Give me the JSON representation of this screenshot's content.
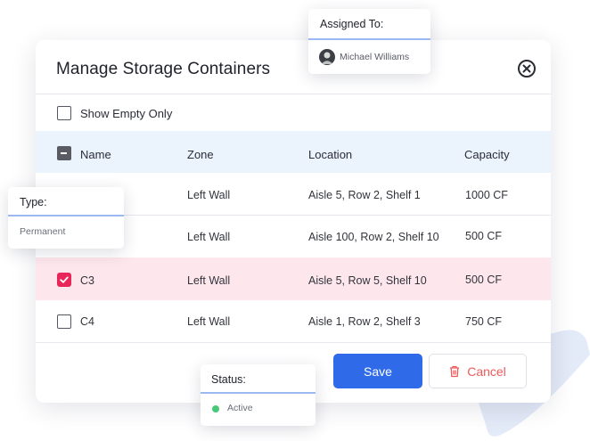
{
  "modal": {
    "title": "Manage Storage Containers",
    "filter_label": "Show Empty Only"
  },
  "table": {
    "columns": [
      "Name",
      "Zone",
      "Location",
      "Capacity"
    ],
    "rows": [
      {
        "name": "",
        "zone": "Left Wall",
        "location": "Aisle 5, Row 2, Shelf 1",
        "capacity": "1000 CF",
        "checked": false
      },
      {
        "name": "",
        "zone": "Left Wall",
        "location": "Aisle 100, Row 2, Shelf 10",
        "capacity": "500 CF",
        "checked": false
      },
      {
        "name": "C3",
        "zone": "Left Wall",
        "location": "Aisle 5, Row 5, Shelf 10",
        "capacity": "500 CF",
        "checked": true
      },
      {
        "name": "C4",
        "zone": "Left Wall",
        "location": "Aisle 1, Row 2, Shelf 3",
        "capacity": "750 CF",
        "checked": false
      }
    ]
  },
  "actions": {
    "save_label": "Save",
    "cancel_label": "Cancel"
  },
  "assigned_card": {
    "title": "Assigned To:",
    "user": "Michael Williams"
  },
  "type_card": {
    "title": "Type:",
    "value": "Permanent"
  },
  "status_card": {
    "title": "Status:",
    "value": "Active"
  },
  "colors": {
    "accent": "#2f6be9",
    "selected_row": "#fde6ec",
    "checkbox_checked": "#e8265a",
    "cancel": "#ee5a5a",
    "status_active": "#49c77a"
  },
  "icons": [
    "close-icon",
    "trash-icon",
    "check-icon",
    "avatar"
  ]
}
